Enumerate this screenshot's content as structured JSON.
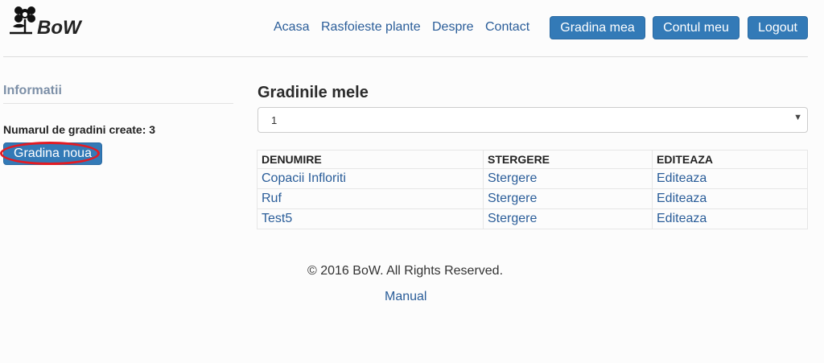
{
  "brand": {
    "name": "BoW",
    "icon": "flower-icon"
  },
  "nav": {
    "links": [
      "Acasa",
      "Rasfoieste plante",
      "Despre",
      "Contact"
    ],
    "buttons": [
      "Gradina mea",
      "Contul meu",
      "Logout"
    ]
  },
  "sidebar": {
    "title": "Informatii",
    "count_text": "Numarul de gradini create: 3",
    "new_button": "Gradina noua"
  },
  "main": {
    "title": "Gradinile mele",
    "select_value": "1",
    "headers": [
      "DENUMIRE",
      "STERGERE",
      "EDITEAZA"
    ],
    "rows": [
      {
        "name": "Copacii Infloriti",
        "delete": "Stergere",
        "edit": "Editeaza"
      },
      {
        "name": "Ruf",
        "delete": "Stergere",
        "edit": "Editeaza"
      },
      {
        "name": "Test5",
        "delete": "Stergere",
        "edit": "Editeaza"
      }
    ]
  },
  "footer": {
    "copyright": "© 2016 BoW. All Rights Reserved.",
    "manual": "Manual"
  },
  "colors": {
    "primary": "#337ab7",
    "link": "#2a5d99",
    "highlight": "#e31b23"
  }
}
